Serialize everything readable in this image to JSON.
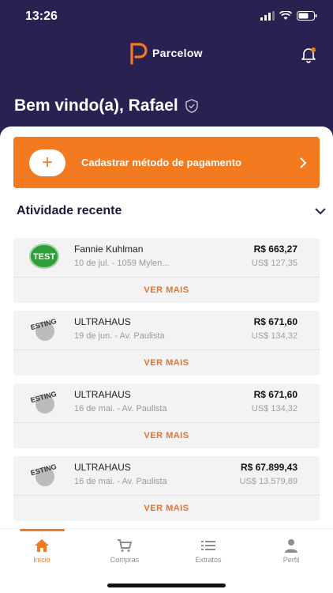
{
  "status": {
    "time": "13:26"
  },
  "header": {
    "brand": "Parcelow"
  },
  "welcome": {
    "text": "Bem vindo(a), Rafael"
  },
  "payment": {
    "label": "Cadastrar método de pagamento"
  },
  "activity": {
    "title": "Atividade recente",
    "items": [
      {
        "merchant": "Fannie Kuhlman",
        "subtitle": "10 de jul. - 1059 Mylen...",
        "brl": "R$ 663,27",
        "usd": "US$ 127,35",
        "more": "VER MAIS",
        "logo": "test-badge"
      },
      {
        "merchant": "ULTRAHAUS",
        "subtitle": "19 de jun. - Av. Paulista",
        "brl": "R$ 671,60",
        "usd": "US$ 134,32",
        "more": "VER MAIS",
        "logo": "testing-logo"
      },
      {
        "merchant": "ULTRAHAUS",
        "subtitle": "16 de mai. - Av. Paulista",
        "brl": "R$ 671,60",
        "usd": "US$ 134,32",
        "more": "VER MAIS",
        "logo": "testing-logo"
      },
      {
        "merchant": "ULTRAHAUS",
        "subtitle": "16 de mai. - Av. Paulista",
        "brl": "R$ 67.899,43",
        "usd": "US$ 13.579,89",
        "more": "VER MAIS",
        "logo": "testing-logo"
      }
    ]
  },
  "tabs": [
    {
      "label": "Início",
      "icon": "home-icon",
      "active": true
    },
    {
      "label": "Compras",
      "icon": "cart-icon",
      "active": false
    },
    {
      "label": "Extratos",
      "icon": "list-icon",
      "active": false
    },
    {
      "label": "Perfil",
      "icon": "person-icon",
      "active": false
    }
  ],
  "colors": {
    "primary": "#2a2150",
    "accent": "#f47a20"
  }
}
